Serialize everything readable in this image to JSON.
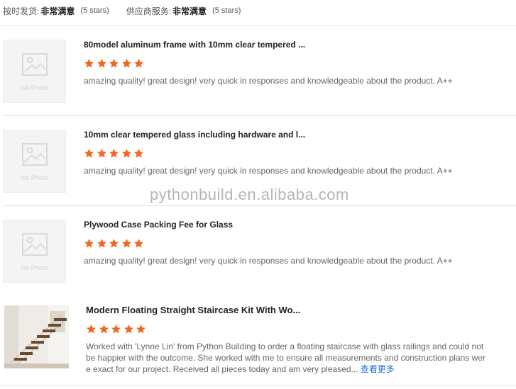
{
  "header": {
    "delivery_label": "按时发货:",
    "delivery_value": "非常满意",
    "delivery_count": "(5 stars)",
    "service_label": "供应商服务:",
    "service_value": "非常满意",
    "service_count": "(5 stars)"
  },
  "colors": {
    "star": "#f26722",
    "link": "#1a73c8"
  },
  "reviews": [
    {
      "title": "80model aluminum frame with 10mm clear tempered ...",
      "rating": 5,
      "text": "amazing quality! great design! very quick in responses and knowledgeable about the product. A++",
      "thumb_label": "No Photo"
    },
    {
      "title": "10mm clear tempered glass including hardware and l...",
      "rating": 5,
      "text": "amazing quality! great design! very quick in responses and knowledgeable about the product. A++",
      "thumb_label": "No Photo"
    },
    {
      "title": "Plywood Case Packing Fee for Glass",
      "rating": 5,
      "text": "amazing quality! great design! very quick in responses and knowledgeable about the product. A++",
      "thumb_label": "No Photo"
    }
  ],
  "featured_review": {
    "title": "Modern Floating Straight Staircase Kit With Wo...",
    "rating": 5,
    "text_lines": [
      "Worked with 'Lynne Lin' from Python Building to order a floating staircase with glass railings and could not",
      "be happier with the outcome. She worked with me to ensure all measurements and construction plans wer",
      "e exact for our project. Received all pieces today and am very pleased..."
    ],
    "more_label": "查看更多"
  },
  "watermark": "pythonbuild.en.alibaba.com"
}
